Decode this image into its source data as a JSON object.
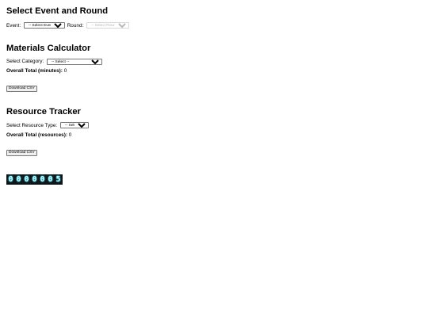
{
  "event_section": {
    "title": "Select Event and Round",
    "event_label": "Event:",
    "event_select": "-- Select Event --",
    "round_label": "Round:",
    "round_select": "-- Select Round --"
  },
  "materials": {
    "title": "Materials Calculator",
    "category_label": "Select Category:",
    "category_select": "-- Select --",
    "total_label": "Overall Total (minutes):",
    "total_value": "0",
    "download_label": "Download CSV"
  },
  "resources": {
    "title": "Resource Tracker",
    "type_label": "Select Resource Type:",
    "type_select": "-- Select --",
    "total_label": "Overall Total (resources):",
    "total_value": "0",
    "download_label": "Download CSV"
  },
  "counter": {
    "digits": [
      "0",
      "0",
      "0",
      "0",
      "0",
      "0",
      "5"
    ],
    "color": "#c8fbff",
    "background": "#0f1a1f"
  }
}
